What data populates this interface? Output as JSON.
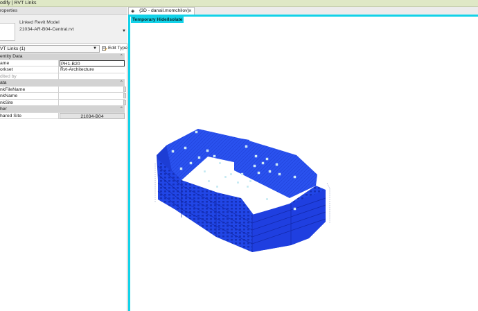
{
  "ribbon": {
    "context_label": "odify | RVT Links"
  },
  "properties": {
    "title": "roperties",
    "type_name_line1": "Linked Revit Model",
    "type_name_line2": "21034-AR-B04-Central.rvt",
    "instance_filter": "VT Links (1)",
    "edit_type_label": "Edit Type",
    "categories": {
      "identity": "entity Data",
      "data": "ata",
      "other": "her"
    },
    "rows": {
      "name_label": "ame",
      "name_value": "PH1-B20",
      "workset_label": "orkset",
      "workset_value": "Rvt-Architecture",
      "edited_by_label": "dited by",
      "edited_by_value": "",
      "link_file_label": "nkFileName",
      "link_name_label": "nkName",
      "link_site_label": "nkSite",
      "shared_site_label": "hared Site",
      "shared_site_value": "21034-B04"
    }
  },
  "view": {
    "tab_label": "{3D - danail.momchilov}",
    "temp_mode_label": "Temporary Hide/Isolate",
    "highlight_color": "#12d2e8",
    "model_color": "#1f3fe0",
    "model_content": "Linked building model (isolated, selected)"
  }
}
